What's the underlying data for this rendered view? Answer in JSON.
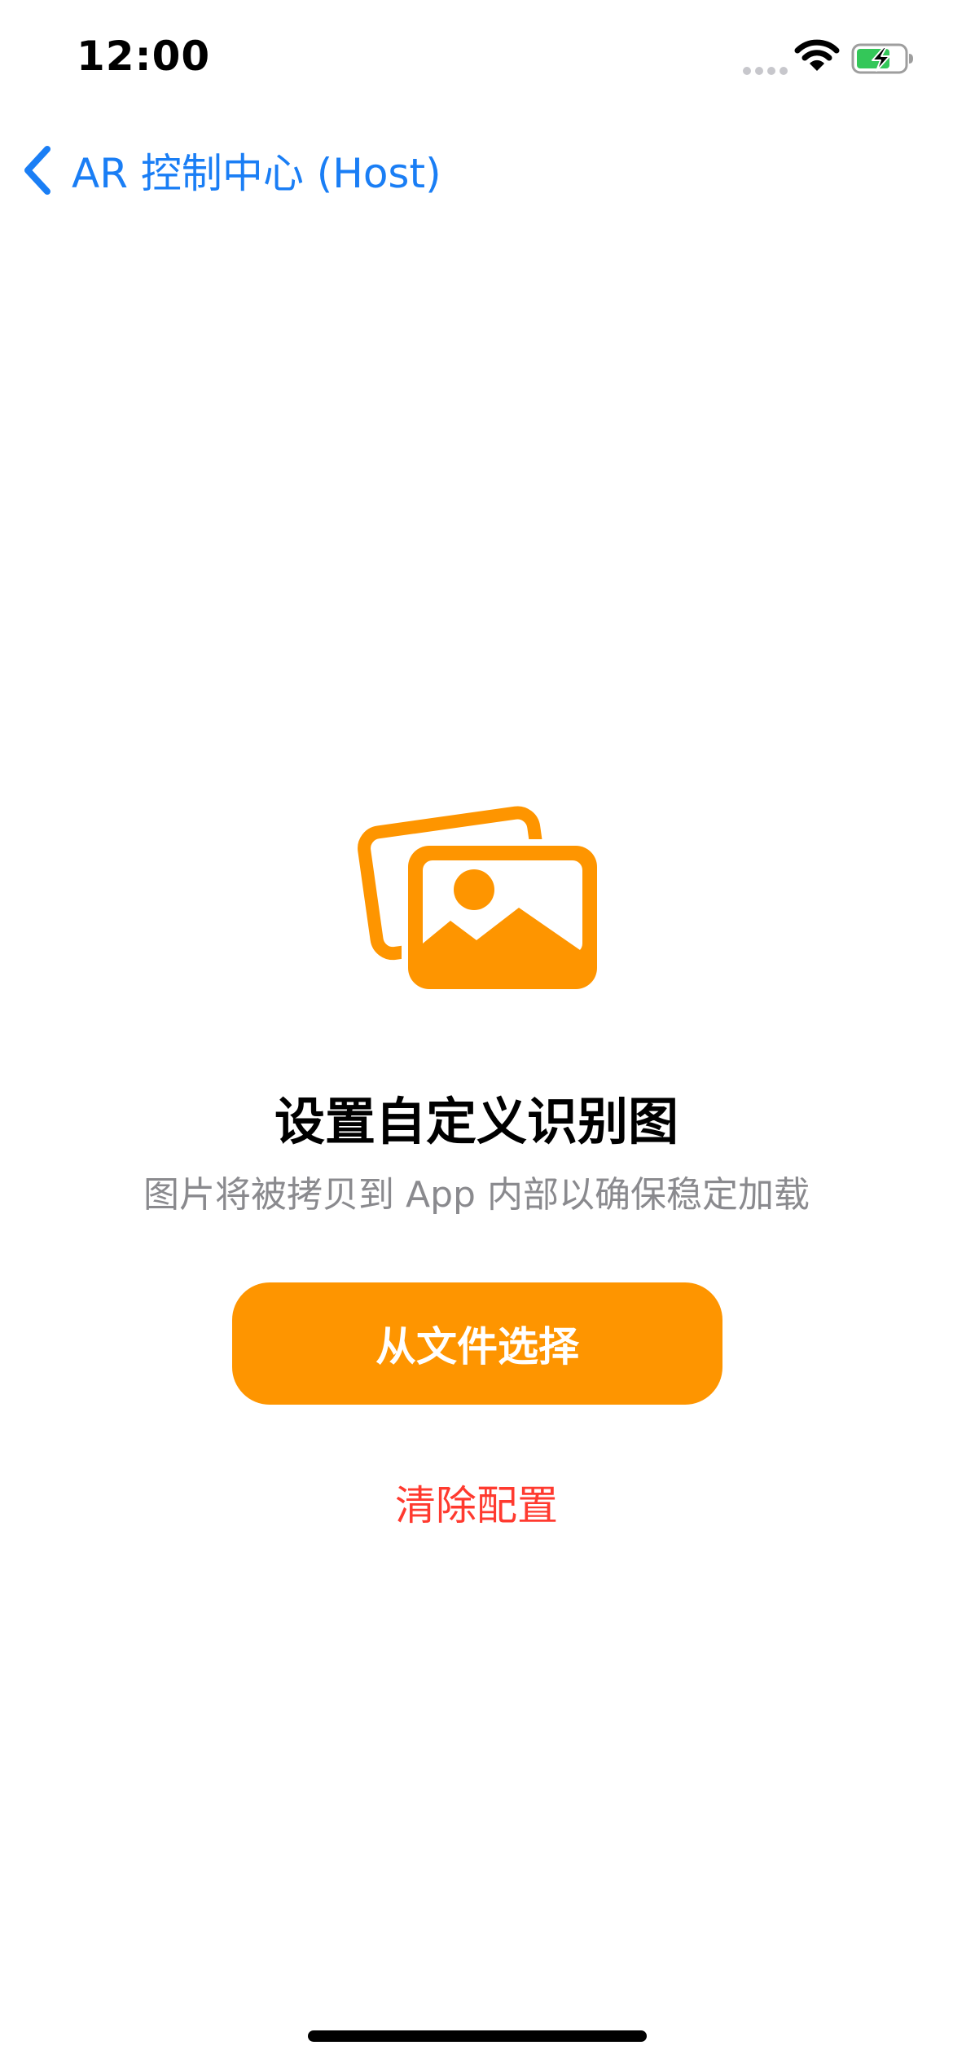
{
  "status_bar": {
    "time": "12:00"
  },
  "nav": {
    "back_label": "AR 控制中心 (Host)"
  },
  "content": {
    "icon": "photo-on-rectangle-icon",
    "title": "设置自定义识别图",
    "subtitle": "图片将被拷贝到 App 内部以确保稳定加载",
    "primary_button_label": "从文件选择",
    "clear_label": "清除配置"
  },
  "colors": {
    "accent_blue": "#1a7ef5",
    "primary_orange": "#fe9500",
    "destructive_red": "#ff3a2f",
    "subtitle_gray": "#8a8a8e",
    "battery_green": "#34c759"
  }
}
